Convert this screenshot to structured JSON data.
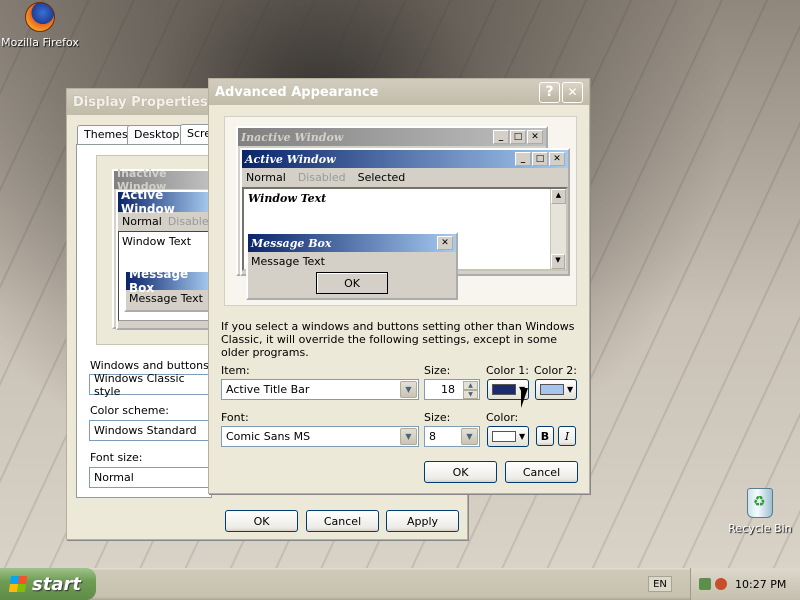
{
  "desktop": {
    "icons": [
      {
        "label": "Mozilla Firefox"
      },
      {
        "label": "Recycle Bin"
      }
    ]
  },
  "display_properties": {
    "title": "Display Properties",
    "tabs": [
      "Themes",
      "Desktop",
      "Scre"
    ],
    "preview": {
      "inactive_title": "Inactive Window",
      "active_title": "Active Window",
      "menu_normal": "Normal",
      "menu_disabled": "Disable",
      "window_text": "Window Text",
      "message_box_title": "Message Box",
      "message_text": "Message Text"
    },
    "windows_buttons_label": "Windows and buttons:",
    "windows_buttons_value": "Windows Classic style",
    "color_scheme_label": "Color scheme:",
    "color_scheme_value": "Windows Standard",
    "font_size_label": "Font size:",
    "font_size_value": "Normal",
    "buttons": {
      "ok": "OK",
      "cancel": "Cancel",
      "apply": "Apply"
    }
  },
  "advanced": {
    "title": "Advanced Appearance",
    "help_glyph": "?",
    "close_glyph": "✕",
    "preview": {
      "inactive_title": "Inactive Window",
      "active_title": "Active Window",
      "menu_normal": "Normal",
      "menu_disabled": "Disabled",
      "menu_selected": "Selected",
      "window_text": "Window Text",
      "message_box_title": "Message Box",
      "message_text": "Message Text",
      "ok": "OK"
    },
    "info_text": "If you select a windows and buttons setting other than Windows Classic, it will override the following settings, except in some older programs.",
    "item_label": "Item:",
    "item_value": "Active Title Bar",
    "size_label": "Size:",
    "item_size": "18",
    "color1_label": "Color 1:",
    "color2_label": "Color 2:",
    "color1": "#1c2a6e",
    "color2": "#a7c4ee",
    "font_label": "Font:",
    "font_value": "Comic Sans MS",
    "font_size_label": "Size:",
    "font_size": "8",
    "font_color_label": "Color:",
    "font_color": "#ffffff",
    "bold_glyph": "B",
    "italic_glyph": "I",
    "ok": "OK",
    "cancel": "Cancel"
  },
  "taskbar": {
    "start_label": "start",
    "language": "EN",
    "time": "10:27 PM"
  }
}
